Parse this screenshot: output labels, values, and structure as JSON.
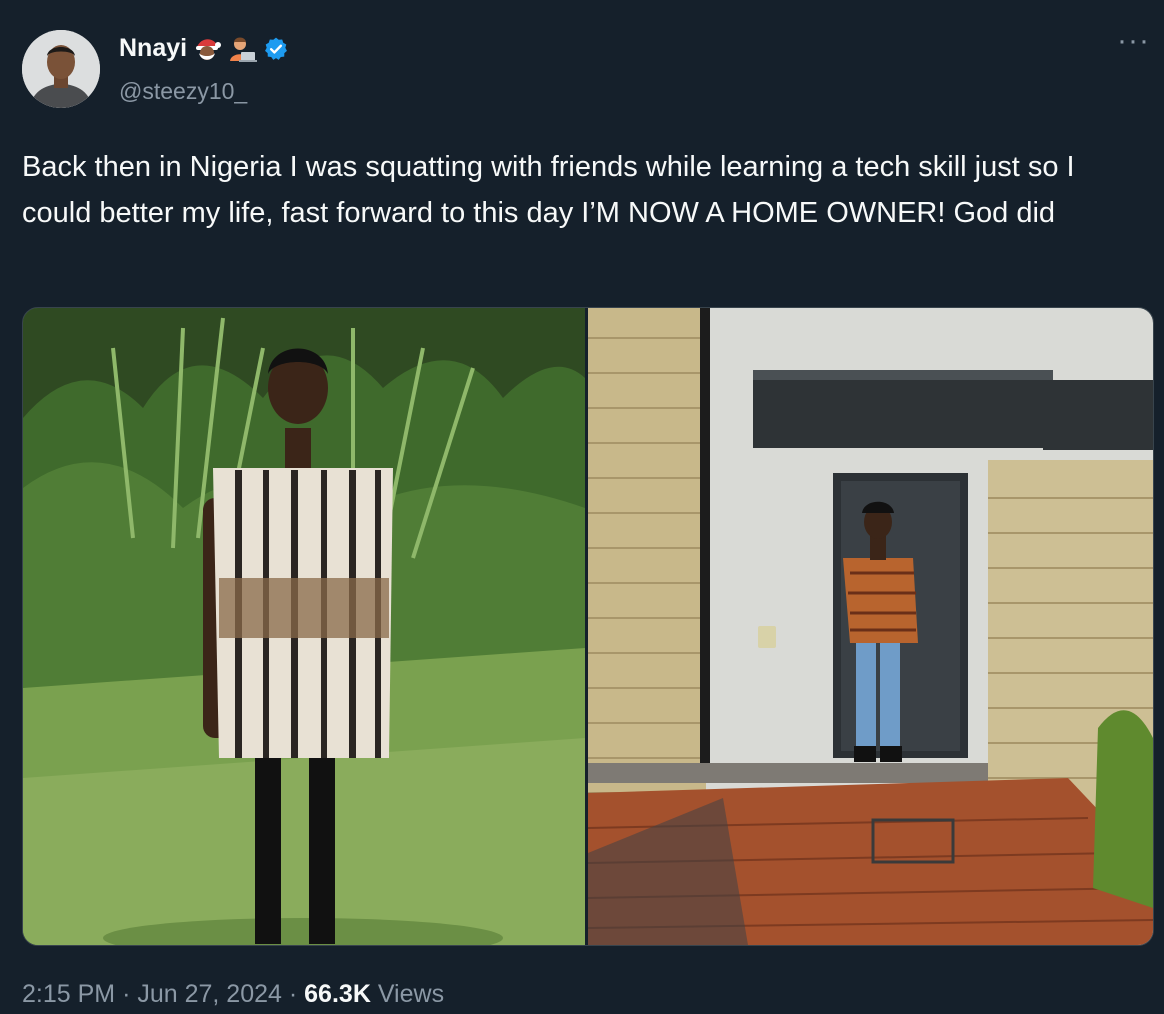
{
  "user": {
    "display_name": "Nnayi",
    "handle": "@steezy10_",
    "name_emojis": [
      "santa-emoji",
      "technologist-emoji"
    ],
    "verified_icon": "verified-badge-icon",
    "verified_color": "#1d9bf0"
  },
  "tweet": {
    "text": "Back then in Nigeria I was squatting with friends while learning a tech skill just so I could better my life, fast forward to this day I’M NOW A HOME OWNER! God did",
    "time": "2:15 PM",
    "date": "Jun 27, 2024",
    "views_count": "66.3K",
    "views_label": "Views",
    "separator": "·"
  },
  "menu": {
    "more_icon": "more-horizontal-icon",
    "more_glyph": "···"
  },
  "theme": {
    "background": "#15202b",
    "text_primary": "#f7f9f9",
    "text_secondary": "#8b98a5",
    "border": "#38444d"
  }
}
